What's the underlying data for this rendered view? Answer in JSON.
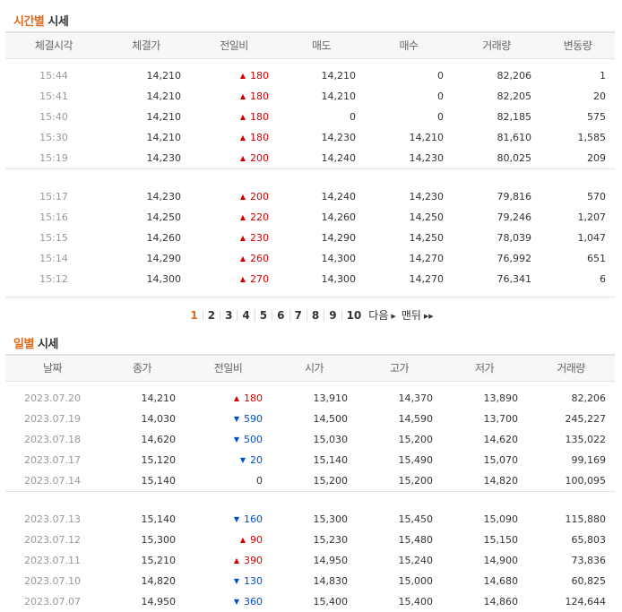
{
  "time_section": {
    "title_accent": "시간별",
    "title_rest": " 시세",
    "headers": [
      "체결시각",
      "체결가",
      "전일비",
      "매도",
      "매수",
      "거래량",
      "변동량"
    ],
    "groups": [
      [
        {
          "time": "15:44",
          "price": "14,210",
          "dir": "up",
          "change": "180",
          "ask": "14,210",
          "bid": "0",
          "volume": "82,206",
          "delta": "1"
        },
        {
          "time": "15:41",
          "price": "14,210",
          "dir": "up",
          "change": "180",
          "ask": "14,210",
          "bid": "0",
          "volume": "82,205",
          "delta": "20"
        },
        {
          "time": "15:40",
          "price": "14,210",
          "dir": "up",
          "change": "180",
          "ask": "0",
          "bid": "0",
          "volume": "82,185",
          "delta": "575"
        },
        {
          "time": "15:30",
          "price": "14,210",
          "dir": "up",
          "change": "180",
          "ask": "14,230",
          "bid": "14,210",
          "volume": "81,610",
          "delta": "1,585"
        },
        {
          "time": "15:19",
          "price": "14,230",
          "dir": "up",
          "change": "200",
          "ask": "14,240",
          "bid": "14,230",
          "volume": "80,025",
          "delta": "209"
        }
      ],
      [
        {
          "time": "15:17",
          "price": "14,230",
          "dir": "up",
          "change": "200",
          "ask": "14,240",
          "bid": "14,230",
          "volume": "79,816",
          "delta": "570"
        },
        {
          "time": "15:16",
          "price": "14,250",
          "dir": "up",
          "change": "220",
          "ask": "14,260",
          "bid": "14,250",
          "volume": "79,246",
          "delta": "1,207"
        },
        {
          "time": "15:15",
          "price": "14,260",
          "dir": "up",
          "change": "230",
          "ask": "14,290",
          "bid": "14,250",
          "volume": "78,039",
          "delta": "1,047"
        },
        {
          "time": "15:14",
          "price": "14,290",
          "dir": "up",
          "change": "260",
          "ask": "14,300",
          "bid": "14,270",
          "volume": "76,992",
          "delta": "651"
        },
        {
          "time": "15:12",
          "price": "14,300",
          "dir": "up",
          "change": "270",
          "ask": "14,300",
          "bid": "14,270",
          "volume": "76,341",
          "delta": "6"
        }
      ]
    ]
  },
  "pager": {
    "pages": [
      "1",
      "2",
      "3",
      "4",
      "5",
      "6",
      "7",
      "8",
      "9",
      "10"
    ],
    "active": "1",
    "next_label": "다음",
    "last_label": "맨뒤"
  },
  "daily_section": {
    "title_accent": "일별",
    "title_rest": " 시세",
    "headers": [
      "날짜",
      "종가",
      "전일비",
      "시가",
      "고가",
      "저가",
      "거래량"
    ],
    "groups": [
      [
        {
          "date": "2023.07.20",
          "close": "14,210",
          "dir": "up",
          "change": "180",
          "open": "13,910",
          "high": "14,370",
          "low": "13,890",
          "volume": "82,206"
        },
        {
          "date": "2023.07.19",
          "close": "14,030",
          "dir": "down",
          "change": "590",
          "open": "14,500",
          "high": "14,590",
          "low": "13,700",
          "volume": "245,227"
        },
        {
          "date": "2023.07.18",
          "close": "14,620",
          "dir": "down",
          "change": "500",
          "open": "15,030",
          "high": "15,200",
          "low": "14,620",
          "volume": "135,022"
        },
        {
          "date": "2023.07.17",
          "close": "15,120",
          "dir": "down",
          "change": "20",
          "open": "15,140",
          "high": "15,490",
          "low": "15,070",
          "volume": "99,169"
        },
        {
          "date": "2023.07.14",
          "close": "15,140",
          "dir": "none",
          "change": "0",
          "open": "15,200",
          "high": "15,200",
          "low": "14,820",
          "volume": "100,095"
        }
      ],
      [
        {
          "date": "2023.07.13",
          "close": "15,140",
          "dir": "down",
          "change": "160",
          "open": "15,300",
          "high": "15,450",
          "low": "15,090",
          "volume": "115,880"
        },
        {
          "date": "2023.07.12",
          "close": "15,300",
          "dir": "up",
          "change": "90",
          "open": "15,230",
          "high": "15,480",
          "low": "15,150",
          "volume": "65,803"
        },
        {
          "date": "2023.07.11",
          "close": "15,210",
          "dir": "up",
          "change": "390",
          "open": "14,950",
          "high": "15,240",
          "low": "14,900",
          "volume": "73,836"
        },
        {
          "date": "2023.07.10",
          "close": "14,820",
          "dir": "down",
          "change": "130",
          "open": "14,830",
          "high": "15,000",
          "low": "14,680",
          "volume": "60,825"
        },
        {
          "date": "2023.07.07",
          "close": "14,950",
          "dir": "down",
          "change": "360",
          "open": "15,400",
          "high": "15,400",
          "low": "14,860",
          "volume": "124,644"
        }
      ]
    ]
  },
  "colors": {
    "accent": "#e06a1c",
    "up": "#d60000",
    "down": "#0050c8"
  },
  "icons": {
    "up": "triangle-up-icon",
    "down": "triangle-down-icon",
    "next": "triangle-right-icon",
    "last": "double-triangle-right-icon"
  }
}
